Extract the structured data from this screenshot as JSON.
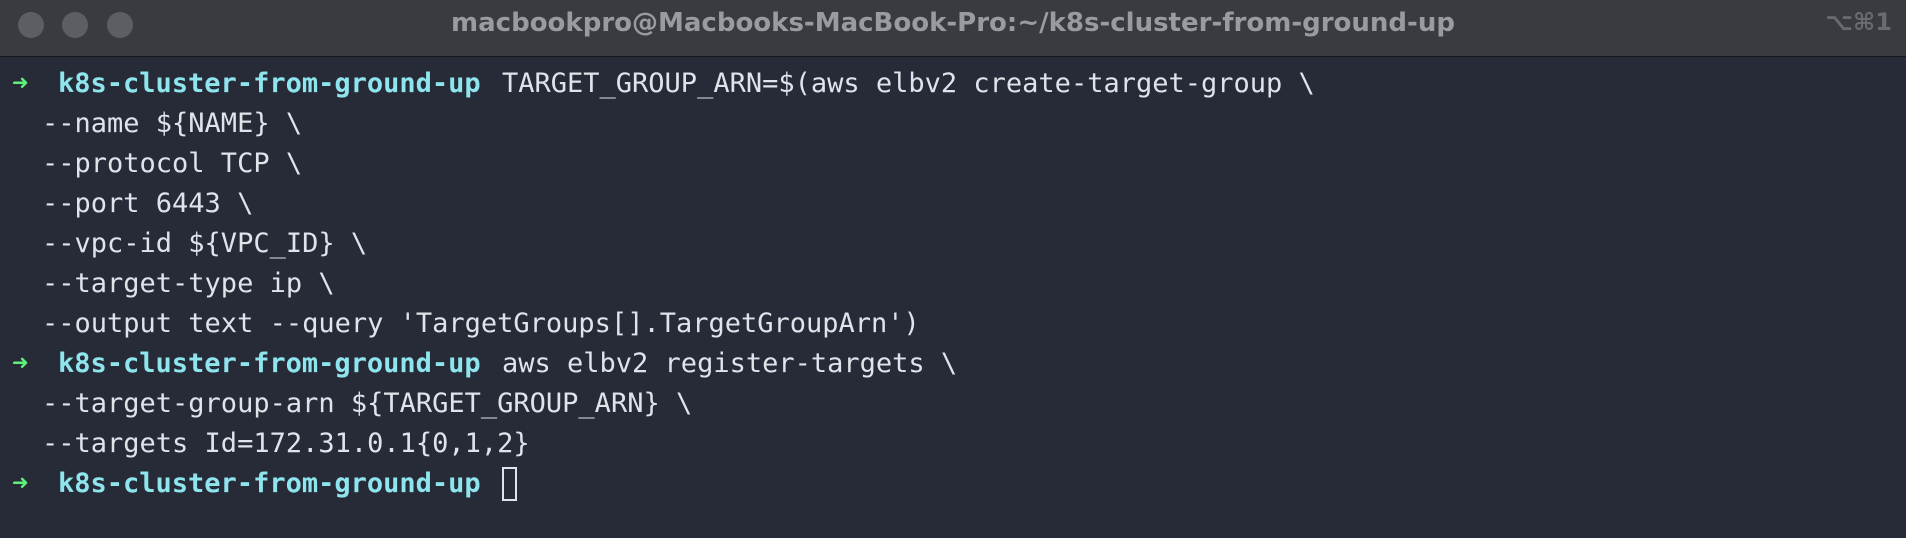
{
  "window": {
    "title": "macbookpro@Macbooks-MacBook-Pro:~/k8s-cluster-from-ground-up",
    "shortcut": "⌥⌘1",
    "traffic_lights": [
      "close-button",
      "minimize-button",
      "zoom-button"
    ],
    "colors": {
      "titlebar": "#3a3b40",
      "background": "#262b37",
      "prompt_arrow": "#5ff07a",
      "prompt_dir": "#8ee5ee",
      "text": "#dfe3ea"
    }
  },
  "terminal": {
    "prompt_symbol": "➜",
    "prompt_dir": "k8s-cluster-from-ground-up",
    "lines": [
      {
        "type": "prompt",
        "text": "TARGET_GROUP_ARN=$(aws elbv2 create-target-group \\"
      },
      {
        "type": "cont",
        "text": "--name ${NAME} \\"
      },
      {
        "type": "cont",
        "text": "--protocol TCP \\"
      },
      {
        "type": "cont",
        "text": "--port 6443 \\"
      },
      {
        "type": "cont",
        "text": "--vpc-id ${VPC_ID} \\"
      },
      {
        "type": "cont",
        "text": "--target-type ip \\"
      },
      {
        "type": "cont",
        "text": "--output text --query 'TargetGroups[].TargetGroupArn')"
      },
      {
        "type": "prompt",
        "text": "aws elbv2 register-targets \\"
      },
      {
        "type": "cont",
        "text": "--target-group-arn ${TARGET_GROUP_ARN} \\"
      },
      {
        "type": "cont",
        "text": "--targets Id=172.31.0.1{0,1,2}"
      },
      {
        "type": "prompt",
        "text": ""
      }
    ]
  }
}
